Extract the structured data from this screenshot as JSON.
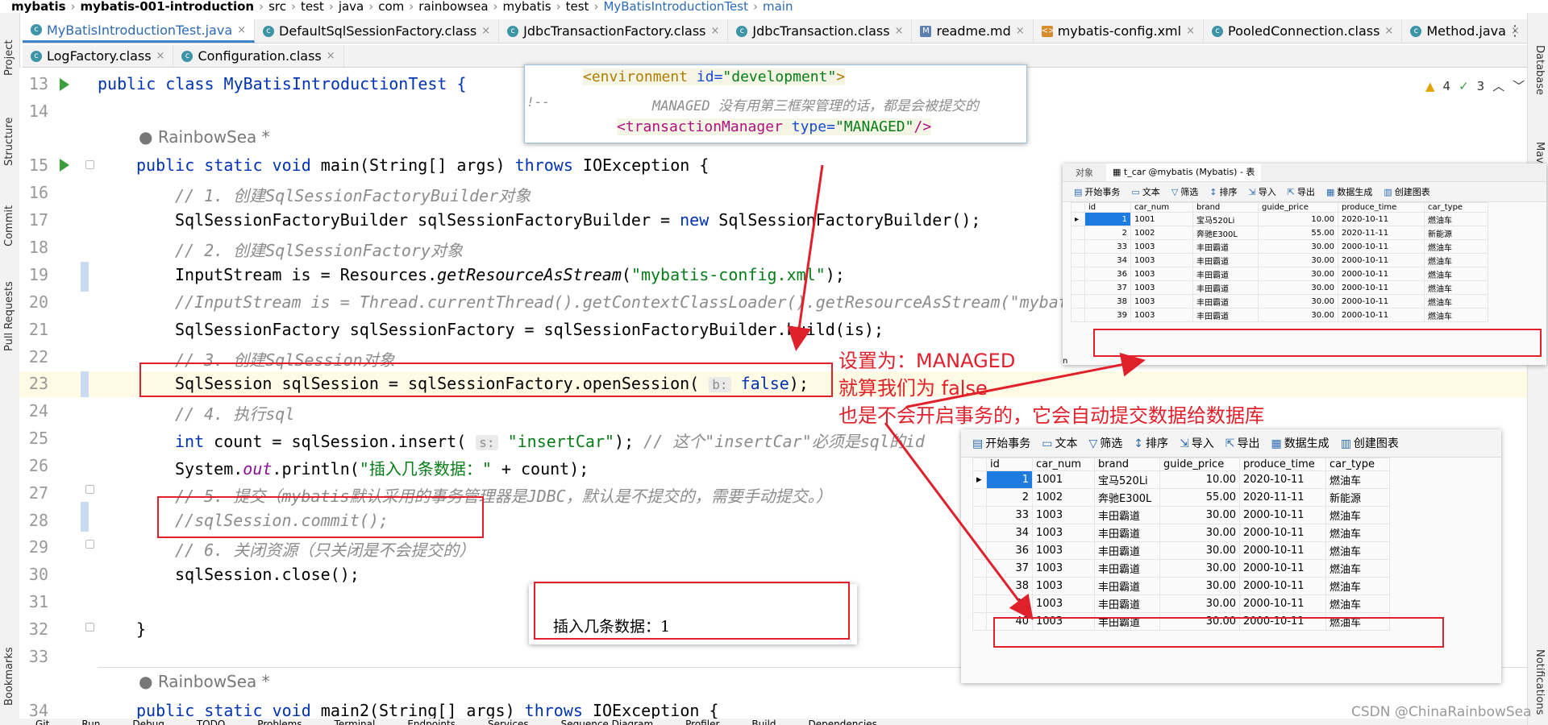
{
  "breadcrumb": [
    "mybatis",
    "mybatis-001-introduction",
    "src",
    "test",
    "java",
    "com",
    "rainbowsea",
    "mybatis",
    "test",
    "MyBatisIntroductionTest",
    "main"
  ],
  "tabs_row1": [
    {
      "label": "MyBatisIntroductionTest.java",
      "icon": "class-icon",
      "active": true
    },
    {
      "label": "DefaultSqlSessionFactory.class",
      "icon": "class-icon"
    },
    {
      "label": "JdbcTransactionFactory.class",
      "icon": "class-icon"
    },
    {
      "label": "JdbcTransaction.class",
      "icon": "class-icon"
    },
    {
      "label": "readme.md",
      "icon": "markdown-icon"
    },
    {
      "label": "mybatis-config.xml",
      "icon": "xml-icon"
    },
    {
      "label": "PooledConnection.class",
      "icon": "class-icon"
    },
    {
      "label": "Method.java",
      "icon": "class-icon"
    }
  ],
  "tabs_row2": [
    {
      "label": "LogFactory.class",
      "icon": "class-icon"
    },
    {
      "label": "Configuration.class",
      "icon": "class-icon"
    }
  ],
  "left_tools": [
    "Project",
    "Structure",
    "Commit",
    "Pull Requests",
    "Bookmarks"
  ],
  "right_tools": [
    "Database",
    "Maven",
    "Notifications"
  ],
  "inspections": {
    "warnings": "4",
    "ok": "3"
  },
  "line_numbers": [
    "13",
    "14",
    "15",
    "16",
    "17",
    "18",
    "19",
    "20",
    "21",
    "22",
    "23",
    "24",
    "25",
    "26",
    "27",
    "28",
    "29",
    "30",
    "31",
    "32",
    "33",
    "34"
  ],
  "code": {
    "l13": "public class MyBatisIntroductionTest {",
    "author1": "RainbowSea *",
    "l15_a": "public static void ",
    "l15_b": "main",
    "l15_c": "(String[] args) ",
    "l15_d": "throws",
    "l15_e": " IOException {",
    "l16": "// 1. 创建SqlSessionFactoryBuilder对象",
    "l17_a": "SqlSessionFactoryBuilder sqlSessionFactoryBuilder = ",
    "l17_b": "new",
    "l17_c": " SqlSessionFactoryBuilder();",
    "l18": "// 2. 创建SqlSessionFactory对象",
    "l19_a": "InputStream is = Resources.",
    "l19_b": "getResourceAsStream",
    "l19_c": "(",
    "l19_d": "\"mybatis-config.xml\"",
    "l19_e": ");",
    "l20": "//InputStream is = Thread.currentThread().getContextClassLoader().getResourceAsStream(\"mybat",
    "l21": "SqlSessionFactory sqlSessionFactory = sqlSessionFactoryBuilder.build(is);",
    "l22": "// 3. 创建SqlSession对象",
    "l23_a": "SqlSession sqlSession = sqlSessionFactory.openSession(",
    "l23_hint": "b:",
    "l23_b": "false",
    "l23_c": ");",
    "l24": "// 4. 执行sql",
    "l25_a": "int",
    "l25_b": " count = sqlSession.insert( ",
    "l25_hint": "s:",
    "l25_c": "\"insertCar\"",
    "l25_d": "); ",
    "l25_e": "// 这个\"insertCar\"必须是sql的id",
    "l26_a": "System.",
    "l26_b": "out",
    "l26_c": ".println(",
    "l26_d": "\"插入几条数据：\"",
    "l26_e": " + count);",
    "l27": "// 5. 提交（mybatis默认采用的事务管理器是JDBC，默认是不提交的，需要手动提交。）",
    "l28": "//sqlSession.commit();",
    "l29": "// 6. 关闭资源（只关闭是不会提交的）",
    "l30": "sqlSession.close();",
    "l32": "}",
    "author2": "RainbowSea *",
    "l34_a": "public static void ",
    "l34_b": "main2",
    "l34_c": "(String[] args) ",
    "l34_d": "throws",
    "l34_e": " IOException {"
  },
  "xml_popup": {
    "line1_tag": "<environment ",
    "line1_attr": "id=",
    "line1_val": "\"development\"",
    "line1_end": ">",
    "line2_prefix": "!--",
    "line2": "MANAGED 没有用第三框架管理的话，都是会被提交的",
    "line3_tag": "<transactionManager ",
    "line3_attr": "type=",
    "line3_val": "\"MANAGED\"",
    "line3_end": "/>"
  },
  "output_popup": {
    "text": "插入几条数据：1"
  },
  "annotation": {
    "line1": "设置为：MANAGED",
    "line2": "就算我们为 false",
    "line3": "也是不会开启事务的，它会自动提交数据给数据库"
  },
  "db_small": {
    "tab_object": "对象",
    "tab_table": "t_car @mybatis (Mybatis) - 表",
    "toolbar": [
      "开始事务",
      "文本",
      "筛选",
      "排序",
      "导入",
      "导出",
      "数据生成",
      "创建图表"
    ],
    "columns": [
      "id",
      "car_num",
      "brand",
      "guide_price",
      "produce_time",
      "car_type"
    ],
    "rows": [
      [
        "1",
        "1001",
        "宝马520Li",
        "10.00",
        "2020-10-11",
        "燃油车"
      ],
      [
        "2",
        "1002",
        "奔驰E300L",
        "55.00",
        "2020-11-11",
        "新能源"
      ],
      [
        "33",
        "1003",
        "丰田霸道",
        "30.00",
        "2000-10-11",
        "燃油车"
      ],
      [
        "34",
        "1003",
        "丰田霸道",
        "30.00",
        "2000-10-11",
        "燃油车"
      ],
      [
        "36",
        "1003",
        "丰田霸道",
        "30.00",
        "2000-10-11",
        "燃油车"
      ],
      [
        "37",
        "1003",
        "丰田霸道",
        "30.00",
        "2000-10-11",
        "燃油车"
      ],
      [
        "38",
        "1003",
        "丰田霸道",
        "30.00",
        "2000-10-11",
        "燃油车"
      ],
      [
        "39",
        "1003",
        "丰田霸道",
        "30.00",
        "2000-10-11",
        "燃油车"
      ]
    ],
    "status": "n"
  },
  "db_large": {
    "toolbar": [
      "开始事务",
      "文本",
      "筛选",
      "排序",
      "导入",
      "导出",
      "数据生成",
      "创建图表"
    ],
    "columns": [
      "id",
      "car_num",
      "brand",
      "guide_price",
      "produce_time",
      "car_type"
    ],
    "rows": [
      [
        "1",
        "1001",
        "宝马520Li",
        "10.00",
        "2020-10-11",
        "燃油车"
      ],
      [
        "2",
        "1002",
        "奔驰E300L",
        "55.00",
        "2020-11-11",
        "新能源"
      ],
      [
        "33",
        "1003",
        "丰田霸道",
        "30.00",
        "2000-10-11",
        "燃油车"
      ],
      [
        "34",
        "1003",
        "丰田霸道",
        "30.00",
        "2000-10-11",
        "燃油车"
      ],
      [
        "36",
        "1003",
        "丰田霸道",
        "30.00",
        "2000-10-11",
        "燃油车"
      ],
      [
        "37",
        "1003",
        "丰田霸道",
        "30.00",
        "2000-10-11",
        "燃油车"
      ],
      [
        "38",
        "1003",
        "丰田霸道",
        "30.00",
        "2000-10-11",
        "燃油车"
      ],
      [
        "39",
        "1003",
        "丰田霸道",
        "30.00",
        "2000-10-11",
        "燃油车"
      ],
      [
        "40",
        "1003",
        "丰田霸道",
        "30.00",
        "2000-10-11",
        "燃油车"
      ]
    ]
  },
  "watermark": "CSDN @ChinaRainbowSea",
  "bottom_tools": [
    "Git",
    "Run",
    "Debug",
    "TODO",
    "Problems",
    "Terminal",
    "Endpoints",
    "Services",
    "Sequence Diagram",
    "Profiler",
    "Build",
    "Dependencies"
  ],
  "colors": {
    "annotation_red": "#e0202a",
    "keyword": "#0033b3",
    "string": "#067d17",
    "comment": "#8c8c8c",
    "active_tab": "#2d6ab4",
    "current_line": "#fffae3"
  }
}
